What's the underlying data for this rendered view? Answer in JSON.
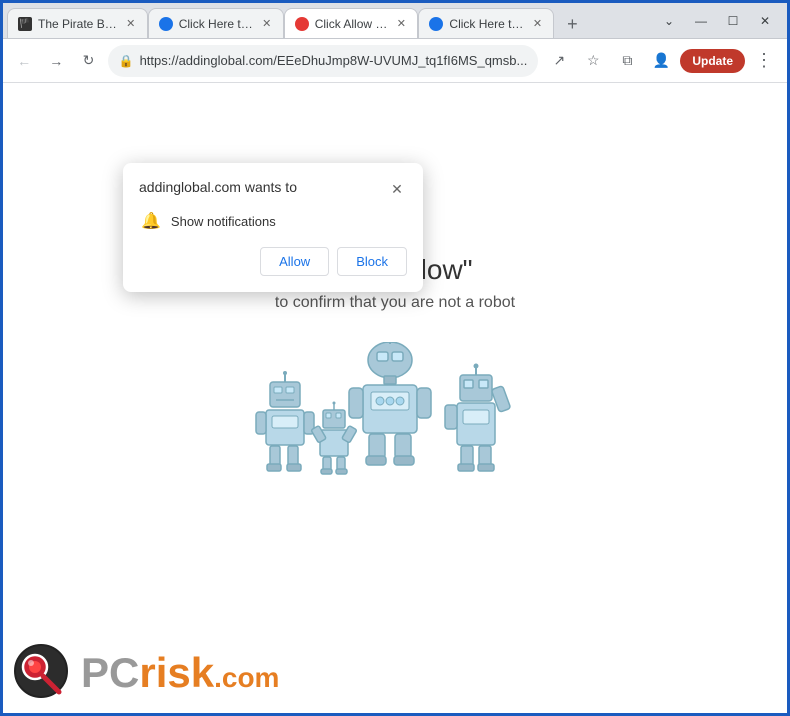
{
  "browser": {
    "tabs": [
      {
        "id": 1,
        "title": "The Pirate B…",
        "favicon": "pirate",
        "active": false
      },
      {
        "id": 2,
        "title": "Click Here t…",
        "favicon": "blue",
        "active": false
      },
      {
        "id": 3,
        "title": "Click Allow …",
        "favicon": "red",
        "active": true
      },
      {
        "id": 4,
        "title": "Click Here t…",
        "favicon": "blue",
        "active": false
      }
    ],
    "address": "https://addinglobal.com/EEeDhuJmp8W-UVUMJ_tq1fI6MS_qmsb...",
    "window_controls": {
      "minimize": "—",
      "maximize": "☐",
      "close": "✕"
    },
    "update_button": "Update",
    "new_tab": "+"
  },
  "popup": {
    "title": "addinglobal.com wants to",
    "close_label": "✕",
    "permission": "Show notifications",
    "allow_label": "Allow",
    "block_label": "Block"
  },
  "page": {
    "heading": "Click \"Allow\"",
    "subheading": "to confirm that you are not a robot"
  },
  "brand": {
    "pc_text": "PC",
    "risk_text": "risk",
    "dotcom_text": ".com"
  },
  "icons": {
    "back": "←",
    "forward": "→",
    "reload": "↻",
    "lock": "🔒",
    "bookmark": "☆",
    "extension": "⧉",
    "profile": "👤",
    "share": "↗",
    "menu": "⋮",
    "chevron_down": "⌄"
  }
}
